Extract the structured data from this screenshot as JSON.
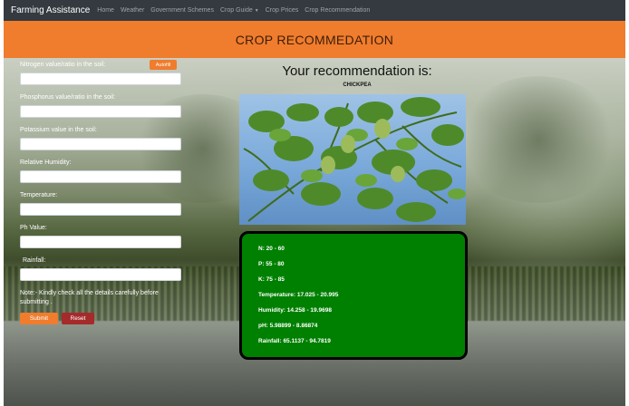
{
  "navbar": {
    "brand": "Farming Assistance",
    "items": [
      {
        "label": "Home"
      },
      {
        "label": "Weather"
      },
      {
        "label": "Government Schemes"
      },
      {
        "label": "Crop Guide"
      },
      {
        "label": "Crop Prices"
      },
      {
        "label": "Crop Recommendation"
      }
    ]
  },
  "header": {
    "title": "CROP RECOMMEDATION"
  },
  "form": {
    "autofill_label": "Autofill",
    "fields": [
      {
        "label": "Nitrogen value/ratio in the soil:",
        "value": ""
      },
      {
        "label": "Phosphorus value/ratio in the soil:",
        "value": ""
      },
      {
        "label": "Potassium value in the soil:",
        "value": ""
      },
      {
        "label": "Relative Humidity:",
        "value": ""
      },
      {
        "label": "Temperature:",
        "value": ""
      },
      {
        "label": "Ph Value:",
        "value": ""
      },
      {
        "label": "Rainfall:",
        "value": ""
      }
    ],
    "note": "Note:- Kindly check all the details carefully before submitting .",
    "submit_label": "Submit",
    "reset_label": "Reset"
  },
  "result": {
    "heading": "Your recommendation is:",
    "crop": "CHICKPEA",
    "details": [
      "N: 20 - 60",
      "P: 55 - 80",
      "K: 75 - 85",
      "Temperature: 17.025 - 20.995",
      "Humidity: 14.258 - 19.9698",
      "pH: 5.98899 - 8.86874",
      "Rainfall: 65.1137 - 94.7819"
    ]
  },
  "colors": {
    "navbar": "#343a40",
    "accent": "#f07c2d",
    "reset": "#a52a2a",
    "details_bg": "#008000"
  }
}
